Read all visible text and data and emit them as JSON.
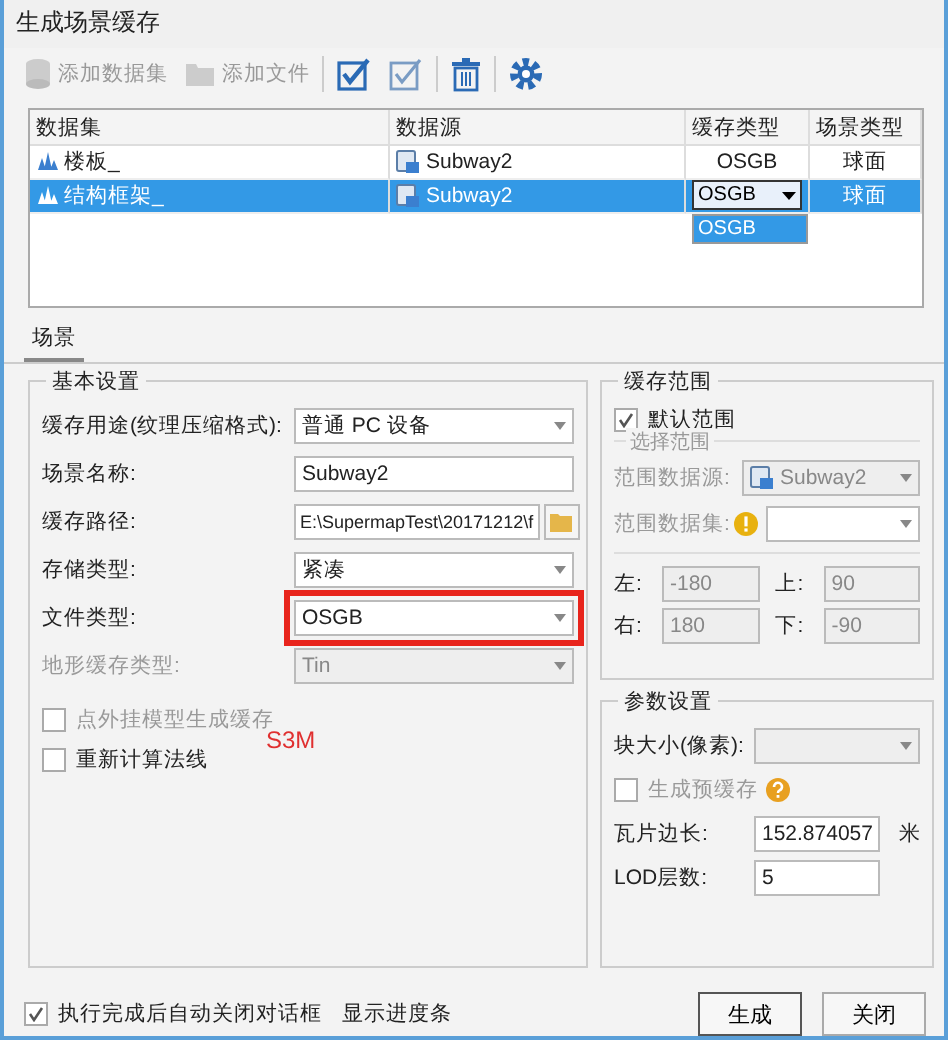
{
  "window": {
    "title": "生成场景缓存"
  },
  "toolbar": [
    {
      "kind": "add-dataset",
      "label": "添加数据集",
      "disabled": true
    },
    {
      "kind": "add-file",
      "label": "添加文件",
      "disabled": true
    },
    {
      "kind": "check-all",
      "disabled": false
    },
    {
      "kind": "check-invert",
      "disabled": false
    },
    {
      "kind": "delete",
      "disabled": false
    },
    {
      "kind": "settings",
      "disabled": false
    }
  ],
  "table": {
    "columns": [
      "数据集",
      "数据源",
      "缓存类型",
      "场景类型"
    ],
    "rows": [
      {
        "dataset": "楼板_",
        "datasource": "Subway2",
        "cache_type": "OSGB",
        "scene_type": "球面",
        "selected": false,
        "dropdown_open": false
      },
      {
        "dataset": "结构框架_",
        "datasource": "Subway2",
        "cache_type": "OSGB",
        "scene_type": "球面",
        "selected": true,
        "dropdown_open": true,
        "dropdown_options": [
          "OSGB"
        ]
      }
    ]
  },
  "tabs": [
    {
      "label": "场景",
      "selected": true
    }
  ],
  "basic": {
    "title": "基本设置",
    "fields": [
      {
        "kind": "combo",
        "label": "缓存用途(纹理压缩格式):",
        "value": "普通 PC 设备",
        "disabled": false,
        "highlighted": false
      },
      {
        "kind": "text",
        "label": "场景名称:",
        "value": "Subway2",
        "disabled": false,
        "highlighted": false
      },
      {
        "kind": "path",
        "label": "缓存路径:",
        "value": "E:\\SupermapTest\\20171212\\f",
        "disabled": false,
        "highlighted": false
      },
      {
        "kind": "combo",
        "label": "存储类型:",
        "value": "紧凑",
        "disabled": false,
        "highlighted": false
      },
      {
        "kind": "combo",
        "label": "文件类型:",
        "value": "OSGB",
        "disabled": false,
        "highlighted": true
      },
      {
        "kind": "combo",
        "label": "地形缓存类型:",
        "value": "Tin",
        "disabled": true,
        "highlighted": false
      }
    ],
    "checks": [
      {
        "label": "点外挂模型生成缓存",
        "checked": false,
        "disabled": true
      },
      {
        "label": "重新计算法线",
        "checked": false,
        "disabled": false
      }
    ],
    "annotation": "S3M"
  },
  "range": {
    "title": "缓存范围",
    "default_range": {
      "label": "默认范围",
      "checked": true
    },
    "select_title": "选择范围",
    "source": {
      "label": "范围数据源:",
      "value": "Subway2"
    },
    "dataset": {
      "label": "范围数据集:",
      "warning": true
    },
    "bounds": [
      {
        "label": "左:",
        "value": "-180"
      },
      {
        "label": "上:",
        "value": "90"
      },
      {
        "label": "右:",
        "value": "180"
      },
      {
        "label": "下:",
        "value": "-90"
      }
    ]
  },
  "params": {
    "title": "参数设置",
    "block_size": {
      "label": "块大小(像素):"
    },
    "precache": {
      "label": "生成预缓存",
      "checked": false,
      "help": true
    },
    "tile_size": {
      "label": "瓦片边长:",
      "value": "152.874057",
      "unit": "米"
    },
    "lod": {
      "label": "LOD层数:",
      "value": "5"
    }
  },
  "footer": {
    "auto_close": {
      "label": "执行完成后自动关闭对话框",
      "checked": true
    },
    "progress": {
      "label": "显示进度条"
    },
    "buttons": [
      "生成",
      "关闭"
    ]
  }
}
